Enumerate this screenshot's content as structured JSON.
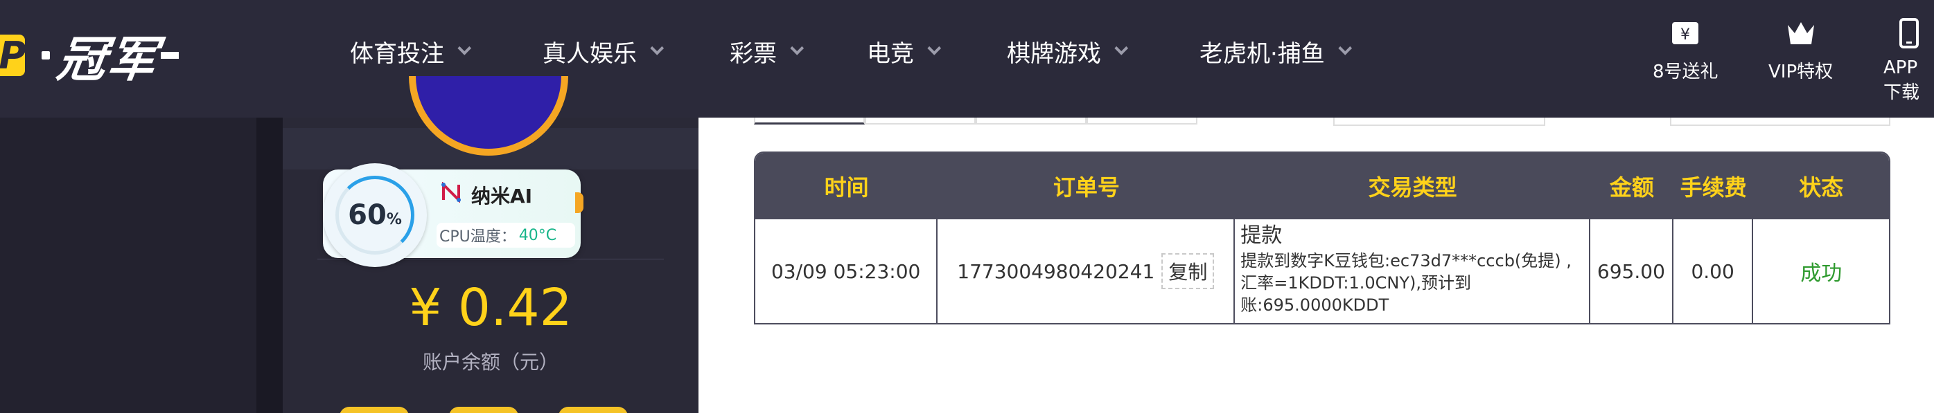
{
  "brand": {
    "logo_letter": "P",
    "logo_text": "冠军"
  },
  "nav": [
    {
      "label": "体育投注"
    },
    {
      "label": "真人娱乐"
    },
    {
      "label": "彩票"
    },
    {
      "label": "电竞"
    },
    {
      "label": "棋牌游戏"
    },
    {
      "label": "老虎机·捕鱼"
    }
  ],
  "header_icons": [
    {
      "label": "8号送礼",
      "icon": "ticket-icon"
    },
    {
      "label": "VIP特权",
      "icon": "crown-icon"
    },
    {
      "label": "APP下载",
      "icon": "phone-icon"
    }
  ],
  "account": {
    "balance": "¥ 0.42",
    "balance_label": "账户余额（元）"
  },
  "ai_widget": {
    "percent": "60",
    "percent_unit": "%",
    "name": "纳米AI",
    "cpu_label": "CPU温度：",
    "cpu_value": "40°C"
  },
  "table": {
    "headers": [
      "时间",
      "订单号",
      "交易类型",
      "金额",
      "手续费",
      "状态"
    ],
    "rows": [
      {
        "time": "03/09 05:23:00",
        "order_no": "1773004980420241",
        "copy_label": "复制",
        "type_title": "提款",
        "type_desc": "提款到数字K豆钱包:ec73d7***cccb(免提) ,汇率=1KDDT:1.0CNY),预计到账:695.0000KDDT",
        "amount": "695.00",
        "fee": "0.00",
        "status": "成功"
      }
    ]
  },
  "colors": {
    "header_bg": "#2b2a3a",
    "accent_yellow": "#ffd21a",
    "table_head_bg": "#4a4a5a",
    "success_green": "#2f9a2f"
  }
}
